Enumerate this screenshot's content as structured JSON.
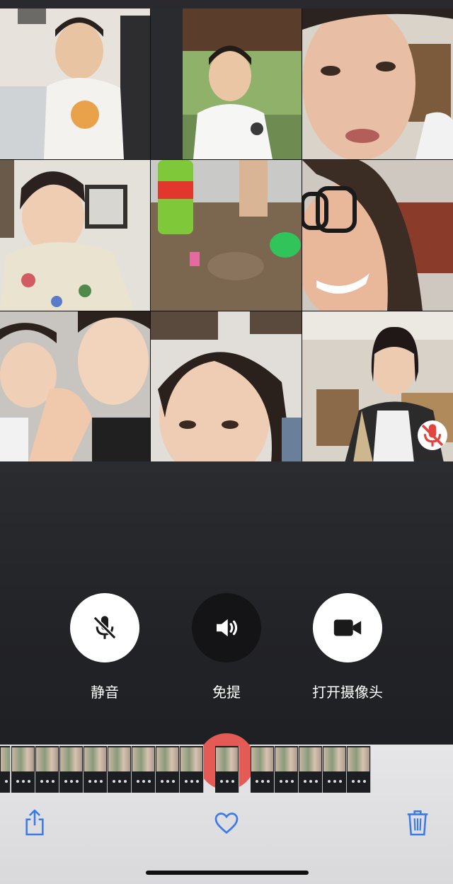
{
  "participants": [
    {
      "name": "participant-1"
    },
    {
      "name": "participant-2"
    },
    {
      "name": "participant-3"
    },
    {
      "name": "participant-4"
    },
    {
      "name": "participant-5"
    },
    {
      "name": "participant-6"
    },
    {
      "name": "participant-7"
    },
    {
      "name": "participant-8"
    },
    {
      "name": "participant-9",
      "muted": true
    }
  ],
  "controls": {
    "mute_label": "静音",
    "speaker_label": "免提",
    "camera_label": "打开摄像头"
  },
  "icons": {
    "mute": "mic-off-icon",
    "speaker": "speaker-icon",
    "camera": "video-camera-icon",
    "share": "share-icon",
    "favorite": "heart-icon",
    "delete": "trash-icon"
  },
  "colors": {
    "accent": "#3b7be8",
    "call_bg": "#1f2023",
    "end_call": "#e45a55"
  }
}
